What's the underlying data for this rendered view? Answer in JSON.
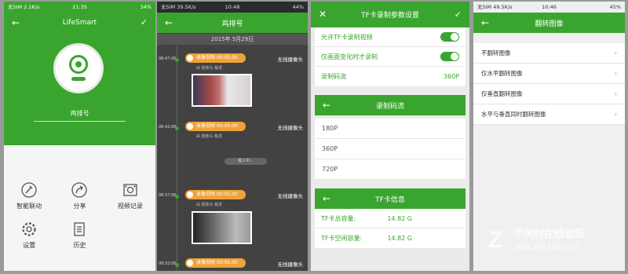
{
  "s1": {
    "status_left": "无SIM 2.1K/s",
    "status_time": "21:35",
    "status_right": "34%",
    "title": "LifeSmart",
    "back": "←",
    "confirm": "✓",
    "device_name": "鸡排号",
    "menu": [
      {
        "label": "智能联动",
        "icon": "wand-icon"
      },
      {
        "label": "分享",
        "icon": "share-icon"
      },
      {
        "label": "视频记录",
        "icon": "film-icon"
      },
      {
        "label": "设置",
        "icon": "gear-icon"
      },
      {
        "label": "历史",
        "icon": "history-icon"
      }
    ]
  },
  "s2": {
    "status_left": "无SIM 39.5K/s",
    "status_time": "10:48",
    "status_right": "44%",
    "title": "鸡排号",
    "back": "←",
    "date": "2015年 5月29日",
    "entries": [
      {
        "time": "08:47:06",
        "label": "录像视频 00:05:00",
        "camera": "无线摄像头",
        "source": "由 摄像头 触发"
      },
      {
        "time": "08:42:06",
        "label": "录像视频 00:05:00",
        "camera": "无线摄像头",
        "source": "由 摄像头 触发"
      },
      {
        "time": "08:37:06",
        "label": "录像视频 00:05:00",
        "camera": "无线摄像头",
        "source": "由 摄像头 触发"
      },
      {
        "time": "08:32:06",
        "label": "录像视频 00:05:00",
        "camera": "无线摄像头",
        "source": ""
      }
    ],
    "loading": "载入中..."
  },
  "s3": {
    "title": "TF卡录制参数设置",
    "close": "✕",
    "confirm": "✓",
    "allow": "允许TF卡录制视频",
    "motion": "仅画面变化时才录制",
    "rate_label": "录制码流",
    "rate_value": "360P",
    "rate_title": "录制码流",
    "rates": [
      "180P",
      "360P",
      "720P"
    ],
    "info_title": "TF卡信息",
    "total_label": "TF卡总容量:",
    "total_value": "14.82 G",
    "free_label": "TF卡空闲容量:",
    "free_value": "14.82 G",
    "back": "←"
  },
  "s4": {
    "status_left": "无SIM 49.5K/s",
    "status_time": "10:46",
    "status_right": "45%",
    "title": "翻转图像",
    "back": "←",
    "options": [
      "不翻转图像",
      "仅水平翻转图像",
      "仅垂直翻转图像",
      "水平与垂直同时翻转图像"
    ]
  },
  "watermark": {
    "line1": "中关村在线论坛",
    "line2": "bbs.zol.com.cn"
  }
}
